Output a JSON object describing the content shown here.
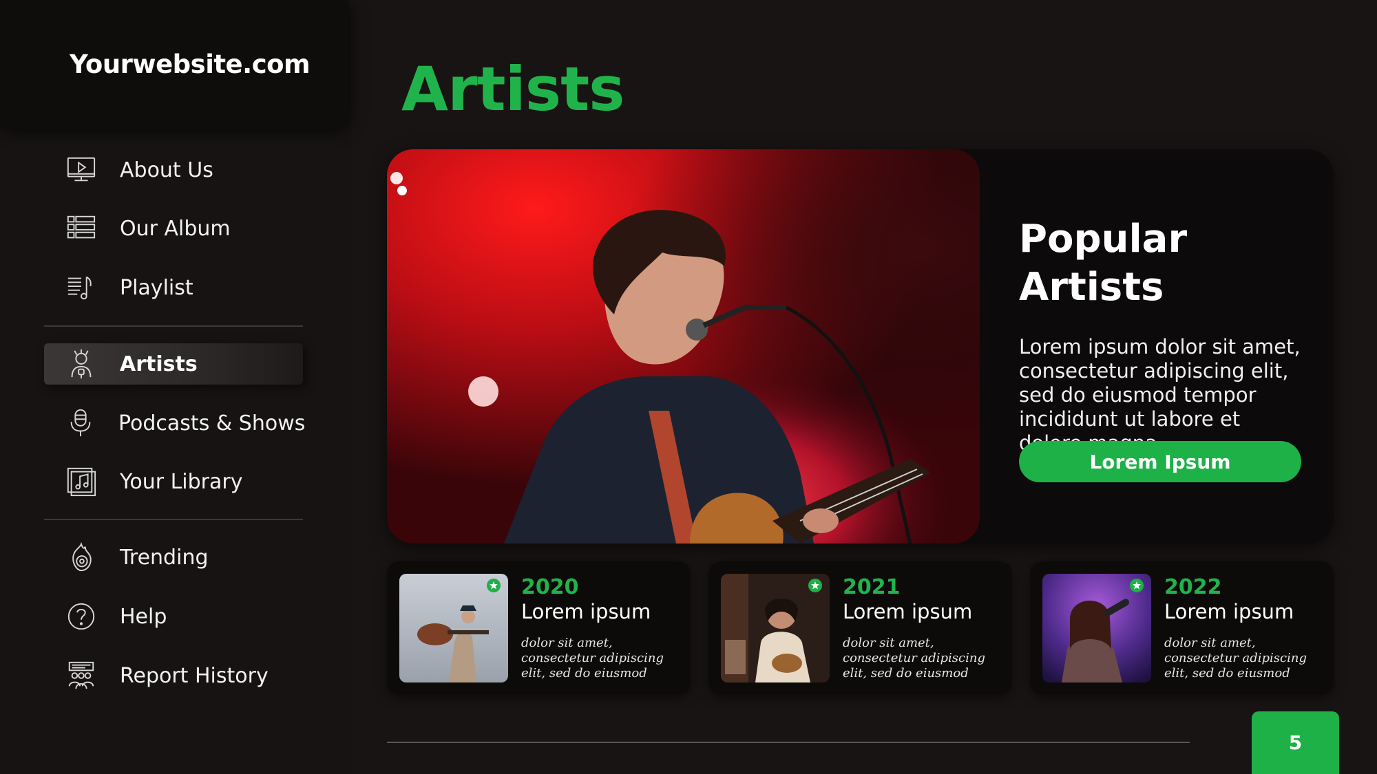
{
  "brand": "Yourwebsite.com",
  "sidebar": {
    "items": [
      {
        "label": "About Us",
        "icon": "monitor-play-icon"
      },
      {
        "label": "Our Album",
        "icon": "list-grid-icon"
      },
      {
        "label": "Playlist",
        "icon": "playlist-music-icon"
      },
      {
        "label": "Artists",
        "icon": "artist-icon",
        "active": true
      },
      {
        "label": "Podcasts & Shows",
        "icon": "microphone-icon"
      },
      {
        "label": "Your Library",
        "icon": "music-library-icon"
      },
      {
        "label": "Trending",
        "icon": "flame-record-icon"
      },
      {
        "label": "Help",
        "icon": "help-circle-icon"
      },
      {
        "label": "Report History",
        "icon": "report-people-icon"
      }
    ]
  },
  "page_title": "Artists",
  "hero": {
    "heading_line1": "Popular",
    "heading_line2": "Artists",
    "body": "Lorem ipsum dolor sit amet, consectetur adipiscing elit, sed do eiusmod tempor incididunt ut labore et dolore magna",
    "button_label": "Lorem Ipsum"
  },
  "cards": [
    {
      "year": "2020",
      "title": "Lorem ipsum",
      "desc": "dolor sit amet, consectetur adipiscing elit, sed do eiusmod"
    },
    {
      "year": "2021",
      "title": "Lorem ipsum",
      "desc": "dolor sit amet, consectetur adipiscing elit, sed do eiusmod"
    },
    {
      "year": "2022",
      "title": "Lorem ipsum",
      "desc": "dolor sit amet, consectetur adipiscing elit, sed do eiusmod"
    }
  ],
  "page_number": "5",
  "colors": {
    "accent": "#1db148",
    "title_green": "#21b34b",
    "background": "#181413"
  }
}
